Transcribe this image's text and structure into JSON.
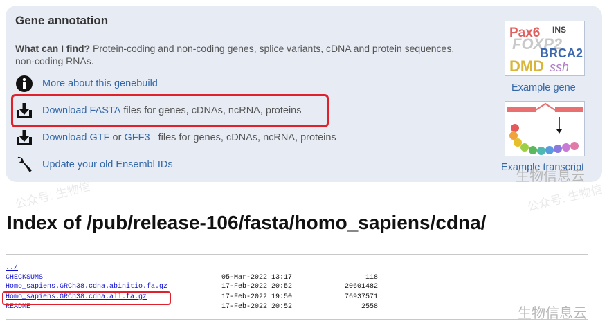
{
  "panel": {
    "title": "Gene annotation",
    "what_label": "What can I find?",
    "what_text": " Protein-coding and non-coding genes, splice variants, cDNA and protein sequences, non-coding RNAs.",
    "rows": [
      {
        "icon": "info-icon",
        "link": "More about this genebuild",
        "suffix": ""
      },
      {
        "icon": "download-icon",
        "link": "Download FASTA",
        "suffix": " files for genes, cDNAs, ncRNA, proteins"
      },
      {
        "icon": "download-icon",
        "link": "Download GTF",
        "middle": " or ",
        "link2": "GFF3",
        "suffix": "   files for genes, cDNAs, ncRNA, proteins"
      },
      {
        "icon": "wrench-icon",
        "link": "Update your old Ensembl IDs",
        "suffix": ""
      }
    ],
    "example_gene": {
      "label": "Example gene",
      "logo_words": [
        "Pax6",
        "INS",
        "FOXP2",
        "BRCA2",
        "DMD",
        "ssh"
      ]
    },
    "example_transcript": {
      "label": "Example transcript"
    }
  },
  "watermark": {
    "text": "生物信息云",
    "faint": "公众号: 生物信"
  },
  "index": {
    "title": "Index of /pub/release-106/fasta/homo_sapiens/cdna/",
    "files": [
      {
        "name": "../",
        "date": "",
        "size": ""
      },
      {
        "name": "CHECKSUMS",
        "date": "05-Mar-2022 13:17",
        "size": "118"
      },
      {
        "name": "Homo_sapiens.GRCh38.cdna.abinitio.fa.gz",
        "date": "17-Feb-2022 20:52",
        "size": "20601482"
      },
      {
        "name": "Homo_sapiens.GRCh38.cdna.all.fa.gz",
        "date": "17-Feb-2022 19:50",
        "size": "76937571"
      },
      {
        "name": "README",
        "date": "17-Feb-2022 20:52",
        "size": "2558"
      }
    ]
  },
  "colors": {
    "panel_bg": "#e7ebf4",
    "link": "#3368a8",
    "highlight": "#e0212b",
    "file_link": "#1010d0"
  }
}
